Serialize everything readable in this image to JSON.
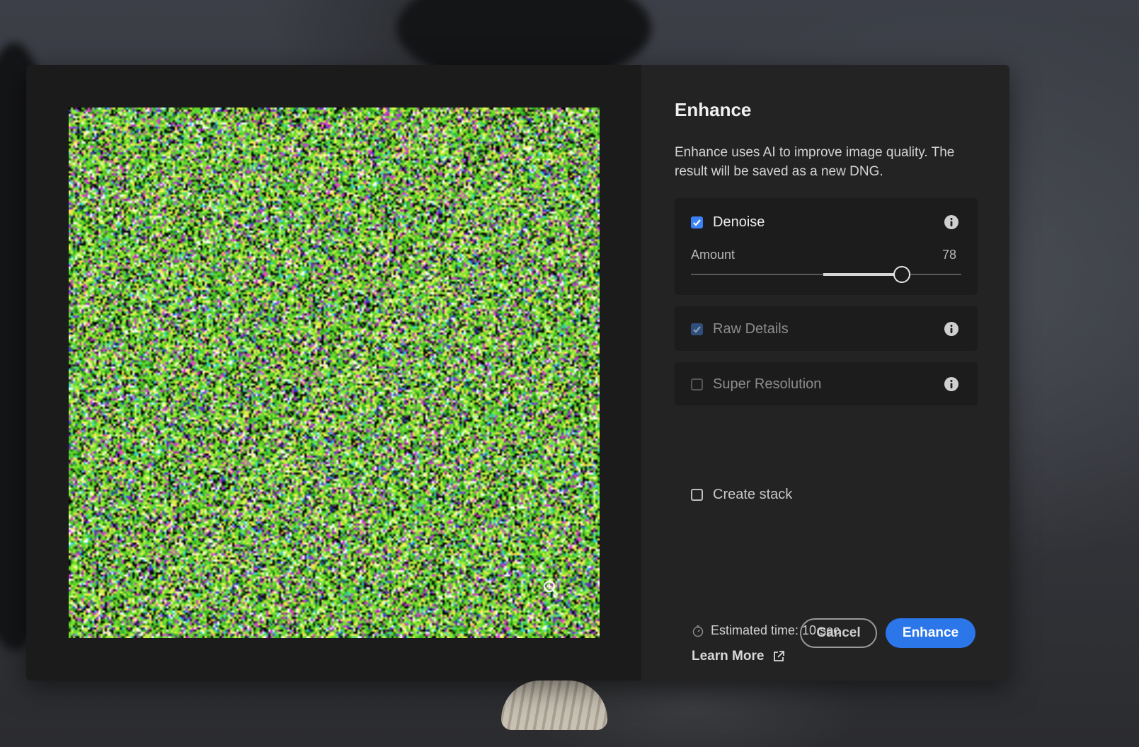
{
  "dialog": {
    "title": "Enhance",
    "description": "Enhance uses AI to improve image quality. The result will be saved as a new DNG."
  },
  "options": {
    "denoise": {
      "label": "Denoise",
      "checked": true,
      "amount_label": "Amount",
      "amount_value": "78",
      "amount_fraction": 0.78
    },
    "raw_details": {
      "label": "Raw Details",
      "checked": true,
      "disabled": true
    },
    "super_resolution": {
      "label": "Super Resolution",
      "checked": false,
      "disabled": true
    },
    "create_stack": {
      "label": "Create stack",
      "checked": false
    }
  },
  "footer": {
    "estimate_text": "Estimated time: 10 sec",
    "learn_more": "Learn More",
    "cancel_label": "Cancel",
    "enhance_label": "Enhance"
  },
  "colors": {
    "accent": "#2b76e8",
    "checkbox_checked": "#3b82f6"
  },
  "icons": [
    "info-icon",
    "timer-icon",
    "external-link-icon",
    "zoom-icon",
    "checkmark-icon"
  ]
}
